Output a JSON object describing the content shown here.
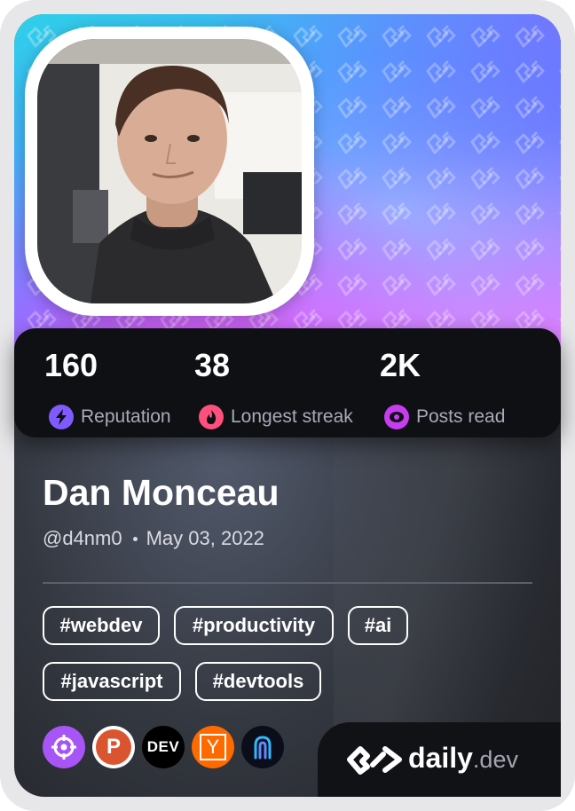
{
  "colors": {
    "card_bg": "#2a2d34",
    "stats_bg": "#0e1014",
    "reputation_icon": "#7f5bff",
    "streak_icon": "#ff4f7d",
    "posts_icon": "#c83cf0",
    "divider": "#5b5f6a"
  },
  "stats": [
    {
      "value": "160",
      "label": "Reputation",
      "icon": "lightning-icon"
    },
    {
      "value": "38",
      "label": "Longest streak",
      "icon": "flame-icon"
    },
    {
      "value": "2K",
      "label": "Posts read",
      "icon": "eye-icon"
    }
  ],
  "profile": {
    "name": "Dan Monceau",
    "handle": "@d4nm0",
    "joined": "May 03, 2022"
  },
  "tags": [
    "#webdev",
    "#productivity",
    "#ai",
    "#javascript",
    "#devtools"
  ],
  "sources": [
    {
      "name": "crosshair-source-icon",
      "color": "#a855f7"
    },
    {
      "name": "product-hunt-source-icon",
      "color": "#ffffff",
      "letter": "P"
    },
    {
      "name": "dev-to-source-icon",
      "color": "#000000",
      "letter": "DEV"
    },
    {
      "name": "hacker-news-source-icon",
      "color": "#ff6a00",
      "letter": "Y"
    },
    {
      "name": "arch-source-icon",
      "color": "#0b0d1a"
    }
  ],
  "brand": {
    "name": "daily",
    "suffix": ".dev"
  }
}
